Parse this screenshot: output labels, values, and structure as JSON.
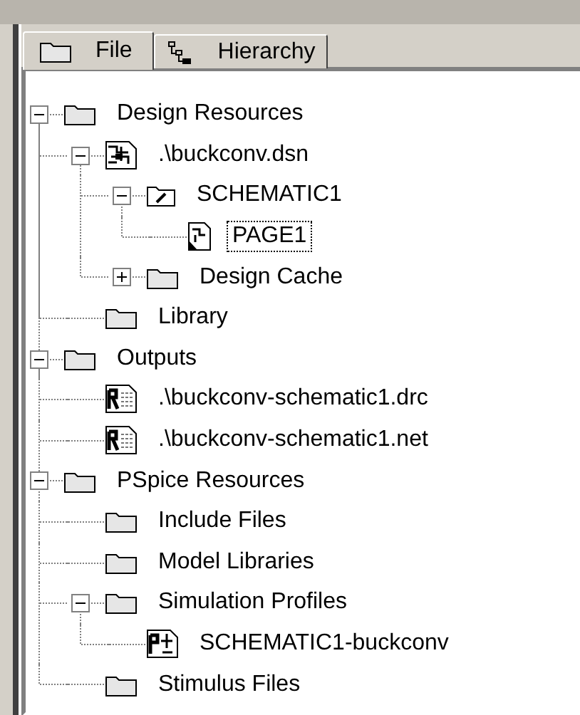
{
  "tabs": [
    {
      "label": "File",
      "kind": "folder",
      "selected": true
    },
    {
      "label": "Hierarchy",
      "kind": "hierarchy",
      "selected": false
    }
  ],
  "tree": [
    {
      "label": "Design Resources",
      "kind": "folder",
      "selected": false,
      "expanded": true,
      "children": [
        {
          "label": ".\\buckconv.dsn",
          "kind": "design",
          "selected": false,
          "expanded": true,
          "children": [
            {
              "label": "SCHEMATIC1",
              "kind": "schematic",
              "selected": false,
              "expanded": true,
              "children": [
                {
                  "label": "PAGE1",
                  "kind": "page",
                  "selected": true
                }
              ]
            },
            {
              "label": "Design Cache",
              "kind": "folder",
              "selected": false,
              "expanded": false
            }
          ]
        },
        {
          "label": "Library",
          "kind": "folder",
          "selected": false
        }
      ]
    },
    {
      "label": "Outputs",
      "kind": "folder",
      "selected": false,
      "expanded": true,
      "children": [
        {
          "label": ".\\buckconv-schematic1.drc",
          "kind": "report",
          "selected": false
        },
        {
          "label": ".\\buckconv-schematic1.net",
          "kind": "report",
          "selected": false
        }
      ]
    },
    {
      "label": "PSpice Resources",
      "kind": "folder",
      "selected": false,
      "expanded": true,
      "children": [
        {
          "label": "Include Files",
          "kind": "folder",
          "selected": false
        },
        {
          "label": "Model Libraries",
          "kind": "folder",
          "selected": false
        },
        {
          "label": "Simulation Profiles",
          "kind": "folder",
          "selected": false,
          "expanded": true,
          "children": [
            {
              "label": "SCHEMATIC1-buckconv",
              "kind": "profile",
              "selected": false
            }
          ]
        },
        {
          "label": "Stimulus Files",
          "kind": "folder",
          "selected": false
        }
      ]
    }
  ]
}
